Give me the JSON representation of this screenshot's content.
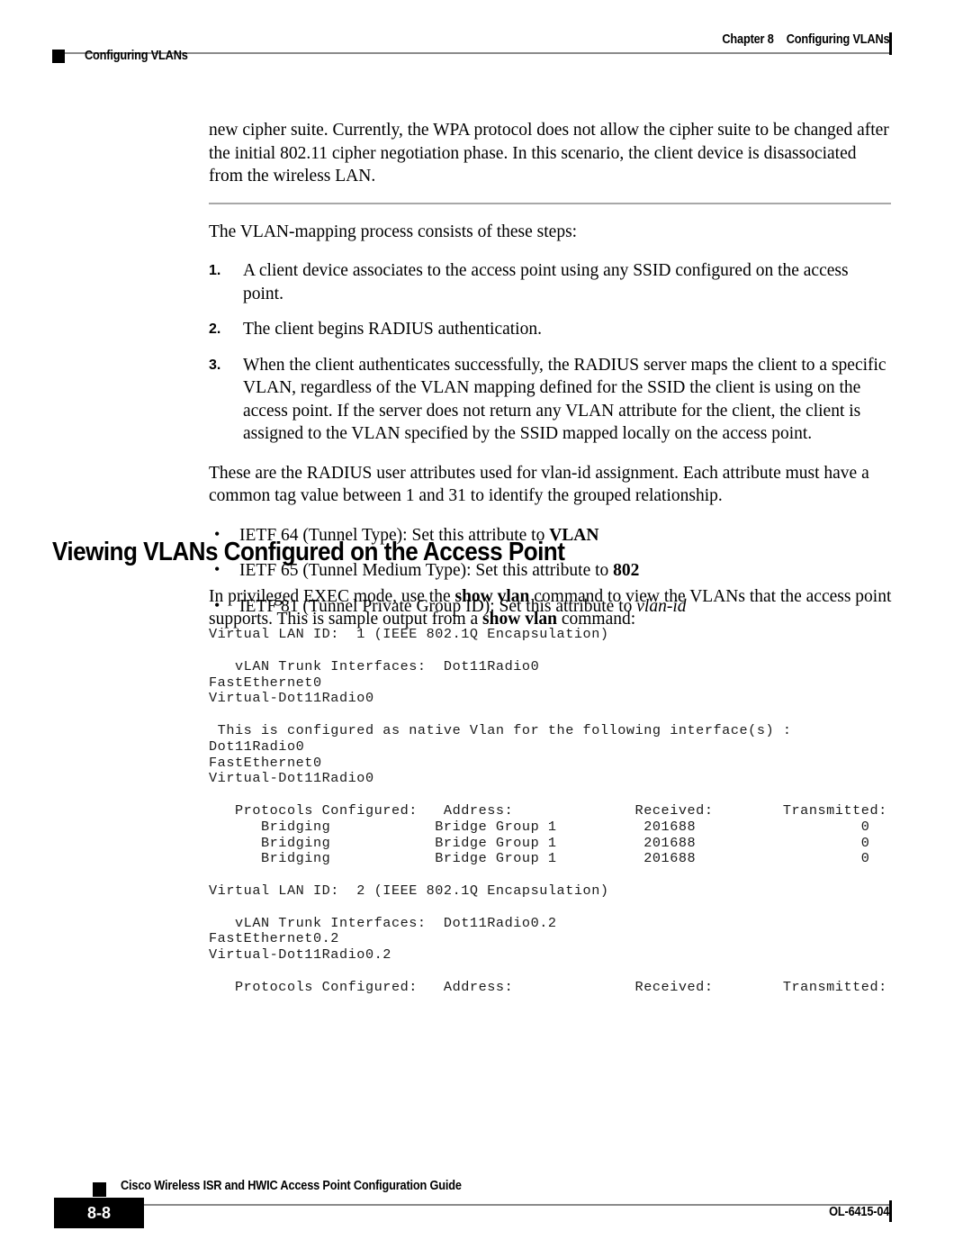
{
  "header": {
    "left_label": "Configuring VLANs",
    "chapter": "Chapter 8",
    "chapter_title": "Configuring VLANs"
  },
  "body": {
    "intro_paragraph": "new cipher suite. Currently, the WPA protocol does not allow the cipher suite to be changed after the initial 802.11 cipher negotiation phase. In this scenario, the client device is disassociated from the wireless LAN.",
    "steps_lead": "The VLAN-mapping process consists of these steps:",
    "steps": [
      {
        "num": "1.",
        "text": "A client device associates to the access point using any SSID configured on the access point."
      },
      {
        "num": "2.",
        "text": "The client begins RADIUS authentication."
      },
      {
        "num": "3.",
        "text": "When the client authenticates successfully, the RADIUS server maps the client to a specific VLAN, regardless of the VLAN mapping defined for the SSID the client is using on the access point. If the server does not return any VLAN attribute for the client, the client is assigned to the VLAN specified by the SSID mapped locally on the access point."
      }
    ],
    "attributes_lead": "These are the RADIUS user attributes used for vlan-id assignment. Each attribute must have a common tag value between 1 and 31 to identify the grouped relationship.",
    "bullets": [
      {
        "bullet": "•",
        "prefix": "IETF 64 (Tunnel Type): Set this attribute to ",
        "emphasis": "VLAN",
        "emphasis_style": "bold"
      },
      {
        "bullet": "•",
        "prefix": "IETF 65 (Tunnel Medium Type): Set this attribute to ",
        "emphasis": "802",
        "emphasis_style": "bold"
      },
      {
        "bullet": "•",
        "prefix": "IETF 81 (Tunnel Private Group ID): Set this attribute to ",
        "emphasis": "vlan-id",
        "emphasis_style": "italic"
      }
    ]
  },
  "section": {
    "heading": "Viewing VLANs Configured on the Access Point",
    "intro_part1": "In privileged EXEC mode, use the ",
    "intro_cmd1": "show vlan",
    "intro_part2": " command to view the VLANs that the access point supports. This is sample output from a ",
    "intro_cmd2": "show vlan",
    "intro_part3": " command:"
  },
  "code_output": "Virtual LAN ID:  1 (IEEE 802.1Q Encapsulation)\n\n   vLAN Trunk Interfaces:  Dot11Radio0\nFastEthernet0\nVirtual-Dot11Radio0\n\n This is configured as native Vlan for the following interface(s) :\nDot11Radio0\nFastEthernet0\nVirtual-Dot11Radio0\n\n   Protocols Configured:   Address:              Received:        Transmitted:\n      Bridging            Bridge Group 1          201688                   0\n      Bridging            Bridge Group 1          201688                   0\n      Bridging            Bridge Group 1          201688                   0\n\nVirtual LAN ID:  2 (IEEE 802.1Q Encapsulation)\n\n   vLAN Trunk Interfaces:  Dot11Radio0.2\nFastEthernet0.2\nVirtual-Dot11Radio0.2\n\n   Protocols Configured:   Address:              Received:        Transmitted:",
  "footer": {
    "page_number": "8-8",
    "guide_title": "Cisco Wireless ISR and HWIC Access Point Configuration Guide",
    "doc_id": "OL-6415-04"
  }
}
